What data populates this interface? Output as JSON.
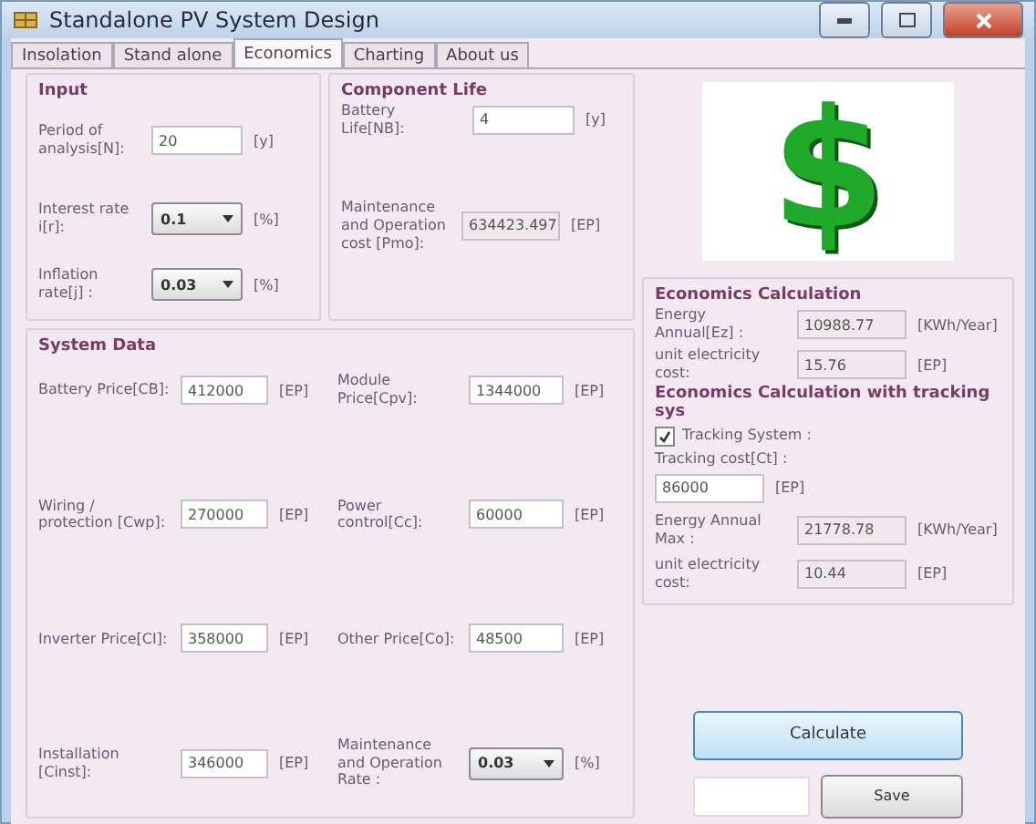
{
  "window": {
    "title": "Standalone PV System Design"
  },
  "tabs": [
    {
      "label": "Insolation",
      "selected": false
    },
    {
      "label": "Stand alone",
      "selected": false
    },
    {
      "label": "Economics",
      "selected": true
    },
    {
      "label": "Charting",
      "selected": false
    },
    {
      "label": "About us",
      "selected": false
    }
  ],
  "input": {
    "title": "Input",
    "rows": [
      {
        "label": "Period of analysis[N]:",
        "value": "20",
        "unit": "[y]",
        "kind": "text"
      },
      {
        "label": "Interest rate i[r]:",
        "value": "0.1",
        "unit": "[%]",
        "kind": "dropdown"
      },
      {
        "label": "Inflation rate[j] :",
        "value": "0.03",
        "unit": "[%]",
        "kind": "dropdown"
      }
    ]
  },
  "component_life": {
    "title": "Component Life",
    "rows": [
      {
        "label": "Battery Life[NB]:",
        "value": "4",
        "unit": "[y]",
        "kind": "text"
      },
      {
        "label": "Maintenance and Operation cost [Pmo]:",
        "value": "634423.497",
        "unit": "[EP]",
        "kind": "readonly"
      }
    ]
  },
  "system_data": {
    "title": "System Data",
    "left": [
      {
        "label": "Battery Price[CB]:",
        "value": "412000",
        "unit": "[EP]",
        "kind": "text"
      },
      {
        "label": "Wiring / protection [Cwp]:",
        "value": "270000",
        "unit": "[EP]",
        "kind": "text"
      },
      {
        "label": "Inverter Price[CI]:",
        "value": "358000",
        "unit": "[EP]",
        "kind": "text"
      },
      {
        "label": "Installation [Cinst]:",
        "value": "346000",
        "unit": "[EP]",
        "kind": "text"
      }
    ],
    "right": [
      {
        "label": "Module Price[Cpv]:",
        "value": "1344000",
        "unit": "[EP]",
        "kind": "text"
      },
      {
        "label": "Power control[Cc]:",
        "value": "60000",
        "unit": "[EP]",
        "kind": "text"
      },
      {
        "label": "Other Price[Co]:",
        "value": "48500",
        "unit": "[EP]",
        "kind": "text"
      },
      {
        "label": "Maintenance and Operation Rate :",
        "value": "0.03",
        "unit": "[%]",
        "kind": "dropdown"
      }
    ]
  },
  "logo_symbol": "$",
  "economics": {
    "title": "Economics Calculation",
    "rows": [
      {
        "label": "Energy Annual[Ez] :",
        "value": "10988.77",
        "unit": "[KWh/Year]",
        "kind": "readonly"
      },
      {
        "label": "unit electricity cost:",
        "value": "15.76",
        "unit": "[EP]",
        "kind": "readonly"
      }
    ],
    "tracking_title": "Economics Calculation with tracking sys",
    "tracking_checkbox": {
      "label": "Tracking System :",
      "checked": true
    },
    "tracking_cost_label": "Tracking cost[Ct] :",
    "tracking_cost": {
      "value": "86000",
      "unit": "[EP]"
    },
    "tracking_rows": [
      {
        "label": "Energy Annual Max :",
        "value": "21778.78",
        "unit": "[KWh/Year]",
        "kind": "readonly"
      },
      {
        "label": "unit electricity cost:",
        "value": "10.44",
        "unit": "[EP]",
        "kind": "readonly"
      }
    ]
  },
  "buttons": {
    "calculate": "Calculate",
    "save": "Save"
  }
}
